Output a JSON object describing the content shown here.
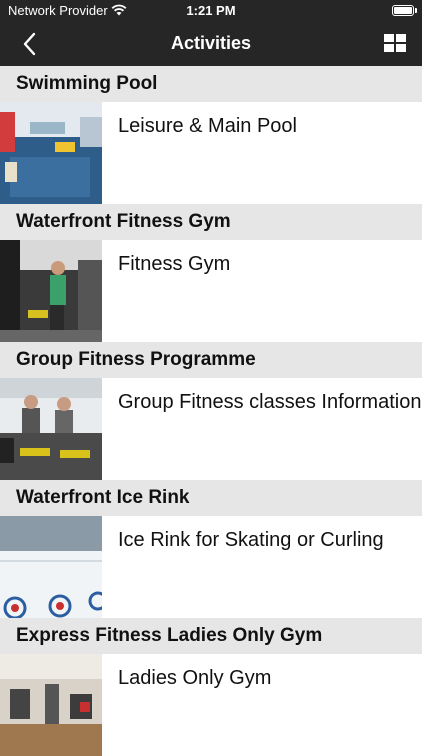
{
  "status": {
    "carrier": "Network Provider",
    "time": "1:21 PM"
  },
  "nav": {
    "title": "Activities"
  },
  "sections": [
    {
      "header": "Swimming Pool",
      "item": "Leisure & Main Pool"
    },
    {
      "header": "Waterfront Fitness Gym",
      "item": "Fitness Gym"
    },
    {
      "header": "Group Fitness Programme",
      "item": "Group Fitness classes Information"
    },
    {
      "header": "Waterfront Ice Rink",
      "item": "Ice Rink for Skating or Curling"
    },
    {
      "header": "Express Fitness Ladies Only Gym",
      "item": "Ladies Only Gym"
    }
  ]
}
